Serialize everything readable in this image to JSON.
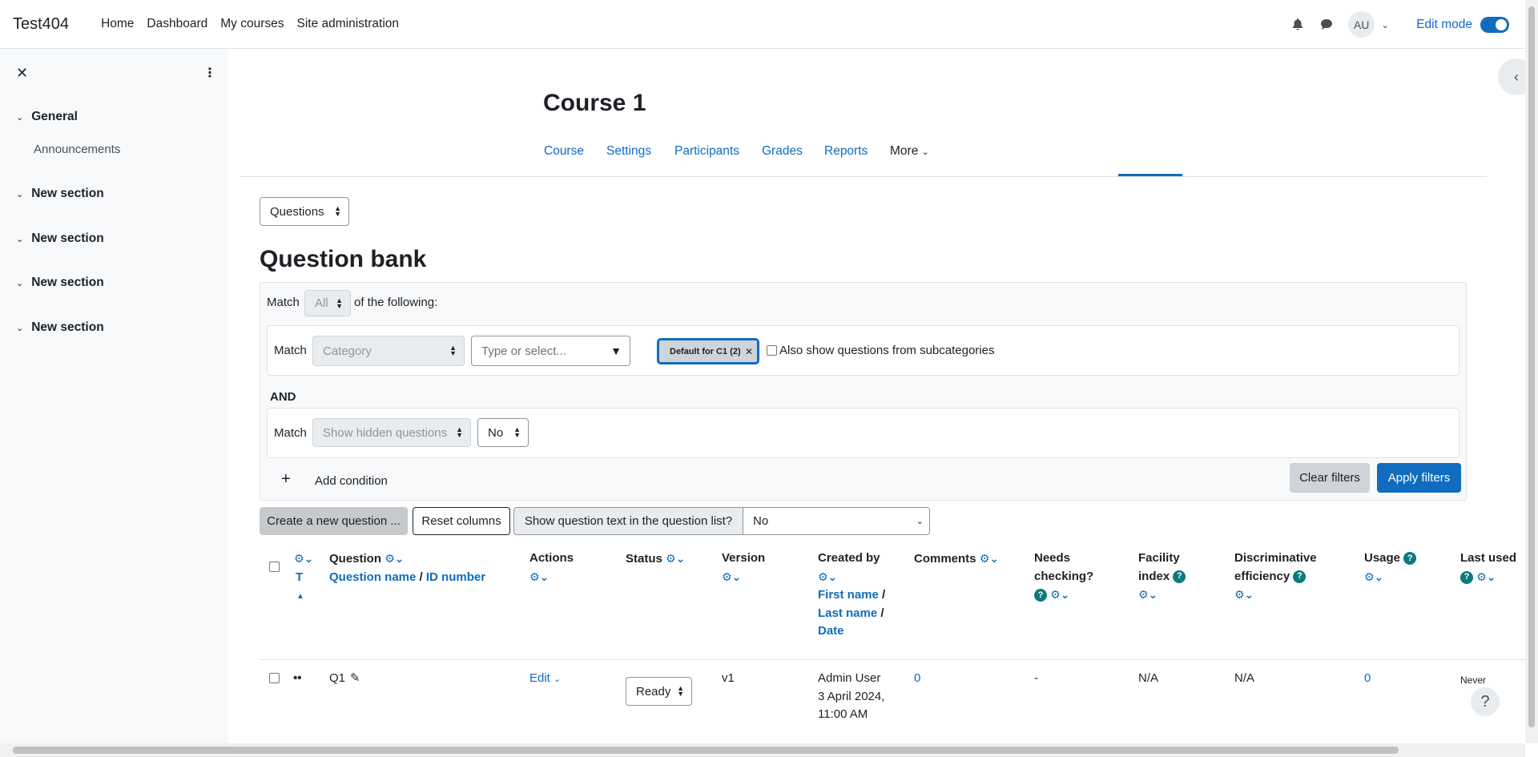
{
  "navbar": {
    "brand": "Test404",
    "links": [
      "Home",
      "Dashboard",
      "My courses",
      "Site administration"
    ],
    "avatar_initials": "AU",
    "edit_mode_label": "Edit mode"
  },
  "drawer": {
    "sections": [
      {
        "title": "General",
        "items": [
          "Announcements"
        ]
      },
      {
        "title": "New section",
        "items": []
      },
      {
        "title": "New section",
        "items": []
      },
      {
        "title": "New section",
        "items": []
      },
      {
        "title": "New section",
        "items": []
      }
    ]
  },
  "course": {
    "title": "Course 1",
    "tabs": [
      "Course",
      "Settings",
      "Participants",
      "Grades",
      "Reports",
      "More"
    ]
  },
  "bank_select": "Questions",
  "page_heading": "Question bank",
  "filters": {
    "match_label": "Match",
    "match_value": "All",
    "of_following": "of the following:",
    "cond1": {
      "label": "Match",
      "type_select": "Category",
      "search_placeholder": "Type or select...",
      "tag": "Default for C1 (2)",
      "subcat_label": "Also show questions from subcategories"
    },
    "and_label": "AND",
    "cond2": {
      "label": "Match",
      "type_select": "Show hidden questions",
      "value_select": "No"
    },
    "add_condition": "Add condition",
    "clear_filters": "Clear filters",
    "apply_filters": "Apply filters"
  },
  "actions": {
    "create_new": "Create a new question ...",
    "reset_columns": "Reset columns",
    "show_text_label": "Show question text in the question list?",
    "show_text_value": "No"
  },
  "table": {
    "headers": {
      "type": "T",
      "question": "Question",
      "question_name": "Question name",
      "id_number": "ID number",
      "actions": "Actions",
      "status": "Status",
      "version": "Version",
      "created_by": "Created by",
      "first_name": "First name",
      "last_name": "Last name",
      "date": "Date",
      "comments": "Comments",
      "needs_checking_1": "Needs",
      "needs_checking_2": "checking?",
      "facility_1": "Facility",
      "facility_2": "index",
      "discrim_1": "Discriminative",
      "discrim_2": "efficiency",
      "usage": "Usage",
      "last_used": "Last used"
    },
    "rows": [
      {
        "name": "Q1",
        "action": "Edit",
        "status": "Ready",
        "version": "v1",
        "created_by": "Admin User",
        "created_date_1": "3 April 2024,",
        "created_date_2": "11:00 AM",
        "comments": "0",
        "needs_checking": "-",
        "facility": "N/A",
        "discrim": "N/A",
        "usage": "0",
        "last_used": "Never"
      }
    ]
  }
}
